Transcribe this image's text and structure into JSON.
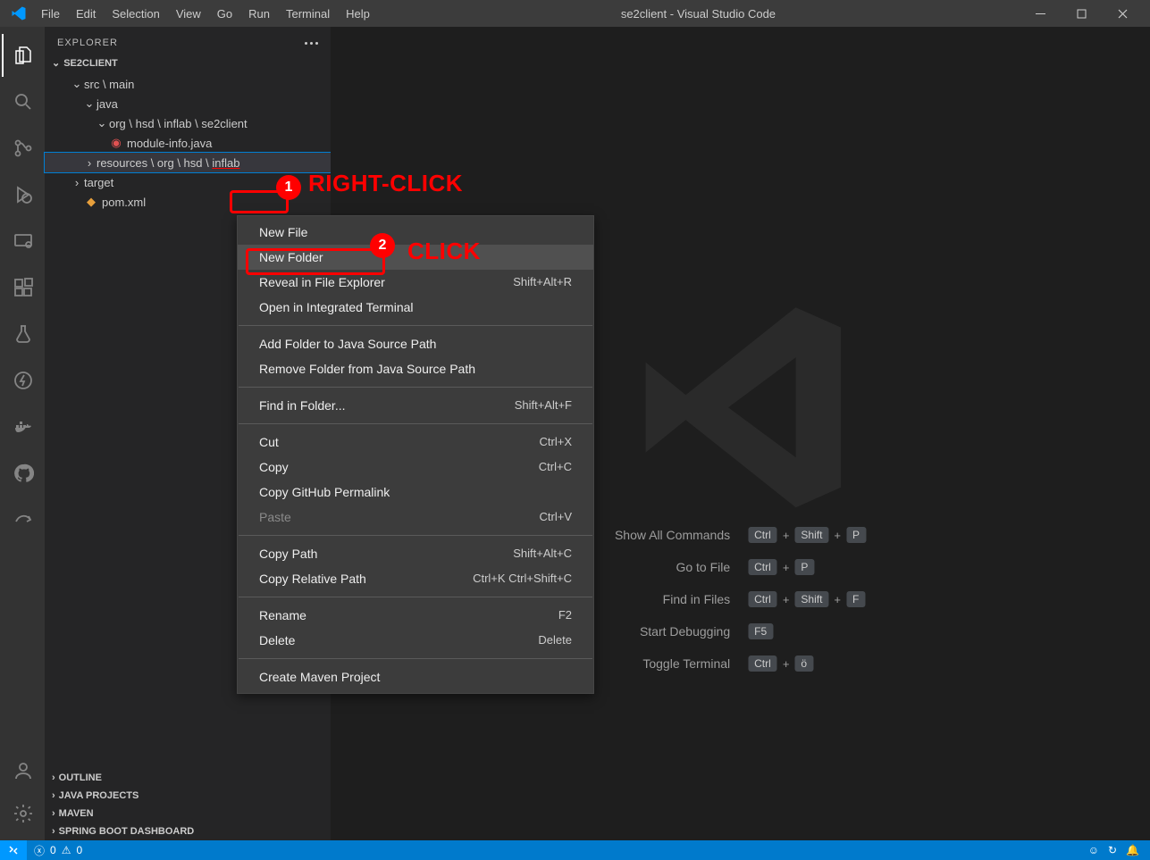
{
  "window": {
    "title": "se2client - Visual Studio Code"
  },
  "menu": {
    "items": [
      "File",
      "Edit",
      "Selection",
      "View",
      "Go",
      "Run",
      "Terminal",
      "Help"
    ]
  },
  "sidebar": {
    "header": "EXPLORER",
    "project": "SE2CLIENT",
    "tree": {
      "srcmain": "src \\ main",
      "java": "java",
      "pkg": "org \\ hsd \\ inflab \\ se2client",
      "module": "module-info.java",
      "resources_prefix": "resources \\ org \\ hsd \\ ",
      "resources_suffix": "inflab",
      "target": "target",
      "pom": "pom.xml"
    },
    "sections": [
      "OUTLINE",
      "JAVA PROJECTS",
      "MAVEN",
      "SPRING BOOT DASHBOARD"
    ]
  },
  "context": {
    "new_file": "New File",
    "new_folder": "New Folder",
    "reveal_explorer": "Reveal in File Explorer",
    "reveal_explorer_key": "Shift+Alt+R",
    "open_terminal": "Open in Integrated Terminal",
    "add_java": "Add Folder to Java Source Path",
    "remove_java": "Remove Folder from Java Source Path",
    "find_folder": "Find in Folder...",
    "find_folder_key": "Shift+Alt+F",
    "cut": "Cut",
    "cut_key": "Ctrl+X",
    "copy": "Copy",
    "copy_key": "Ctrl+C",
    "copy_gh": "Copy GitHub Permalink",
    "paste": "Paste",
    "paste_key": "Ctrl+V",
    "copy_path": "Copy Path",
    "copy_path_key": "Shift+Alt+C",
    "copy_rel_path": "Copy Relative Path",
    "copy_rel_path_key": "Ctrl+K Ctrl+Shift+C",
    "rename": "Rename",
    "rename_key": "F2",
    "delete": "Delete",
    "delete_key": "Delete",
    "create_maven": "Create Maven Project"
  },
  "shortcuts": {
    "show_all": "Show All Commands",
    "goto_file": "Go to File",
    "find_files": "Find in Files",
    "start_debug": "Start Debugging",
    "toggle_term": "Toggle Terminal",
    "keys": {
      "ctrl": "Ctrl",
      "shift": "Shift",
      "p": "P",
      "f": "F",
      "f5": "F5",
      "oe": "ö",
      "plus": "+"
    }
  },
  "status": {
    "errors": "0",
    "warnings": "0"
  },
  "annotations": {
    "rightclick": "RIGHT-CLICK",
    "click": "CLICK",
    "n1": "1",
    "n2": "2"
  }
}
